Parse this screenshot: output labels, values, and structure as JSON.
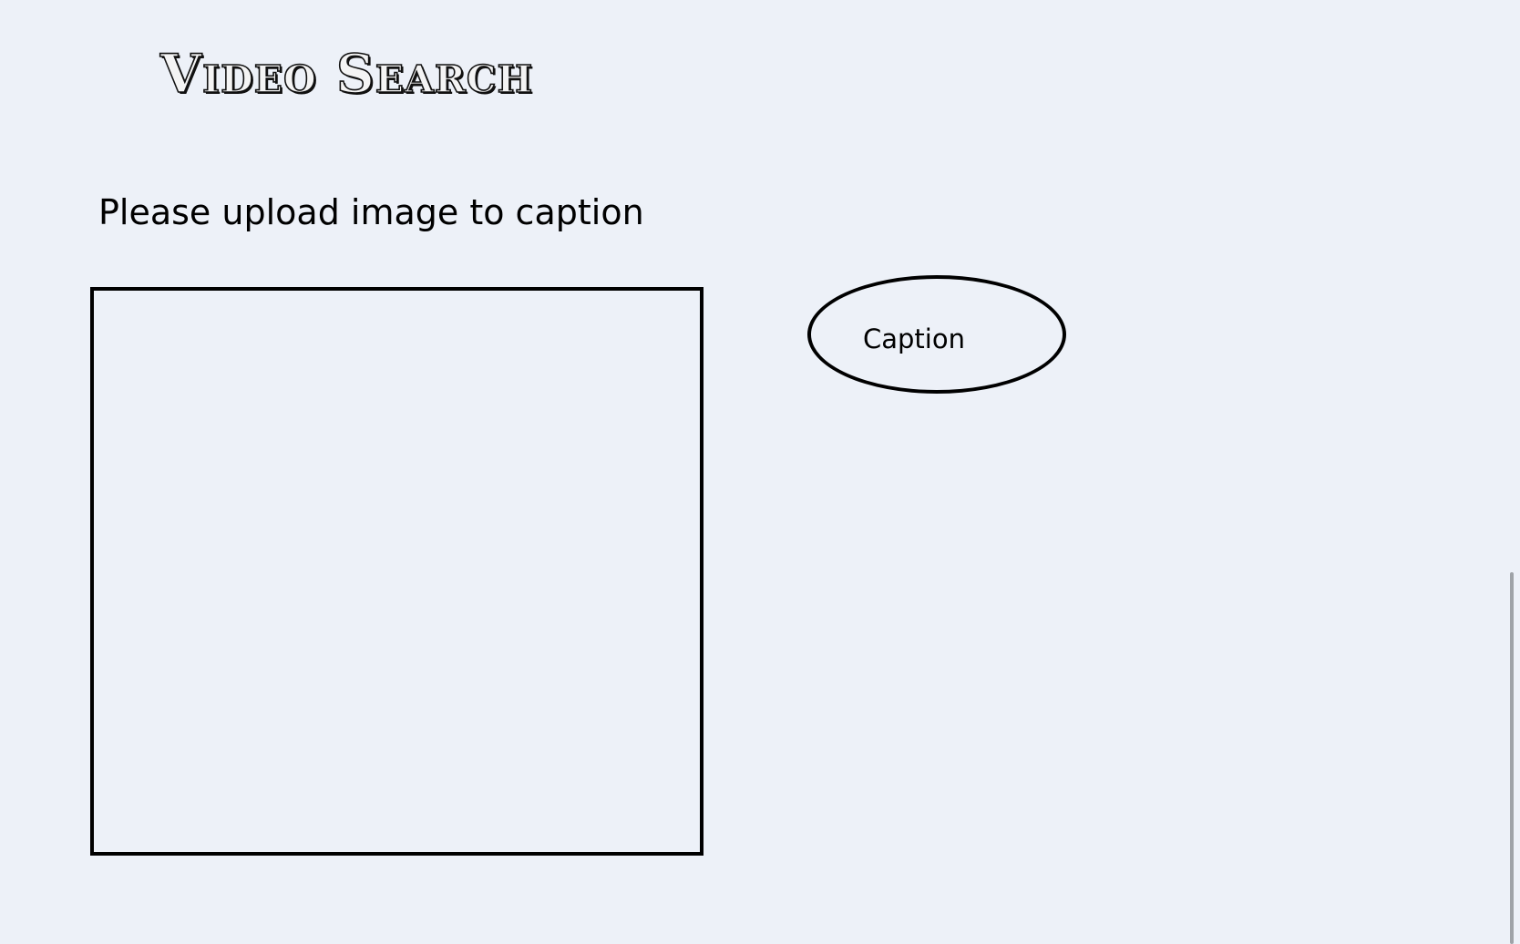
{
  "header": {
    "title": "Video Search"
  },
  "upload": {
    "prompt": "Please upload image to caption"
  },
  "actions": {
    "caption_label": "Caption"
  }
}
